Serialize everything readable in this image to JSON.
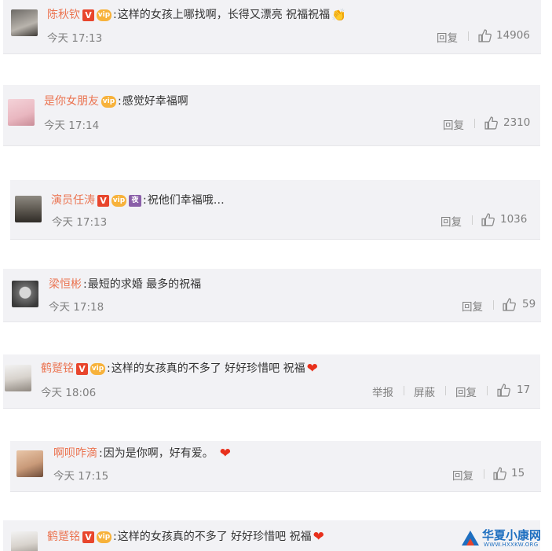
{
  "comments": [
    {
      "user": "陈秋钦",
      "badges": [
        "v",
        "vip"
      ],
      "text": "这样的女孩上哪找啊，长得又漂亮 祝福祝福",
      "emoji": "hands",
      "time": "今天 17:13",
      "actions": [
        "回复"
      ],
      "likes": "14906"
    },
    {
      "user": "是你女朋友",
      "badges": [
        "vip"
      ],
      "text": "感觉好幸福啊",
      "emoji": "",
      "time": "今天 17:14",
      "actions": [
        "回复"
      ],
      "likes": "2310"
    },
    {
      "user": "演员任涛",
      "badges": [
        "v",
        "vip",
        "moon"
      ],
      "text": "祝他们幸福哦…",
      "emoji": "",
      "time": "今天 17:13",
      "actions": [
        "回复"
      ],
      "likes": "1036"
    },
    {
      "user": "梁恒彬",
      "badges": [],
      "text": "最短的求婚  最多的祝福",
      "emoji": "",
      "time": "今天 17:18",
      "actions": [
        "回复"
      ],
      "likes": "59"
    },
    {
      "user": "鹤蹵铭",
      "badges": [
        "v",
        "vip"
      ],
      "text": "这样的女孩真的不多了 好好珍惜吧 祝福",
      "emoji": "heart",
      "time": "今天 18:06",
      "actions": [
        "举报",
        "屏蔽",
        "回复"
      ],
      "likes": "17"
    },
    {
      "user": "啊呗咋滴",
      "badges": [],
      "text": "因为是你啊，好有爱。",
      "emoji": "heart",
      "time": "今天 17:15",
      "actions": [
        "回复"
      ],
      "likes": "15"
    },
    {
      "user": "鹤蹵铭",
      "badges": [
        "v",
        "vip"
      ],
      "text": "这样的女孩真的不多了 好好珍惜吧 祝福",
      "emoji": "heart",
      "time": "",
      "actions": [],
      "likes": ""
    }
  ],
  "badge_labels": {
    "v": "V",
    "vip": "vip",
    "moon": "夜"
  },
  "colon": ":",
  "emoji_glyphs": {
    "heart": "❤",
    "hands": "👏"
  },
  "watermark": {
    "title": "华夏小康网",
    "sub": "WWW.HXXKW.ORG"
  },
  "colors": {
    "username": "#eb7350",
    "card_bg": "#f2f2f5",
    "text": "#333333",
    "meta": "#808080",
    "heart": "#e8301c",
    "watermark": "#1e6fc0"
  }
}
